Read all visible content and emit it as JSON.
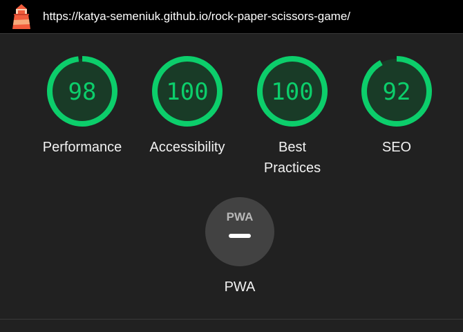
{
  "header": {
    "url": "https://katya-semeniuk.github.io/rock-paper-scissors-game/"
  },
  "colors": {
    "pass_green": "#0cce6b",
    "gauge_fill": "#193b27",
    "pwa_gray": "#424242"
  },
  "gauges": [
    {
      "score": 98,
      "score_text": "98",
      "label": "Performance"
    },
    {
      "score": 100,
      "score_text": "100",
      "label": "Accessibility"
    },
    {
      "score": 100,
      "score_text": "100",
      "label": "Best Practices"
    },
    {
      "score": 92,
      "score_text": "92",
      "label": "SEO"
    }
  ],
  "pwa": {
    "badge_text": "PWA",
    "label": "PWA"
  }
}
